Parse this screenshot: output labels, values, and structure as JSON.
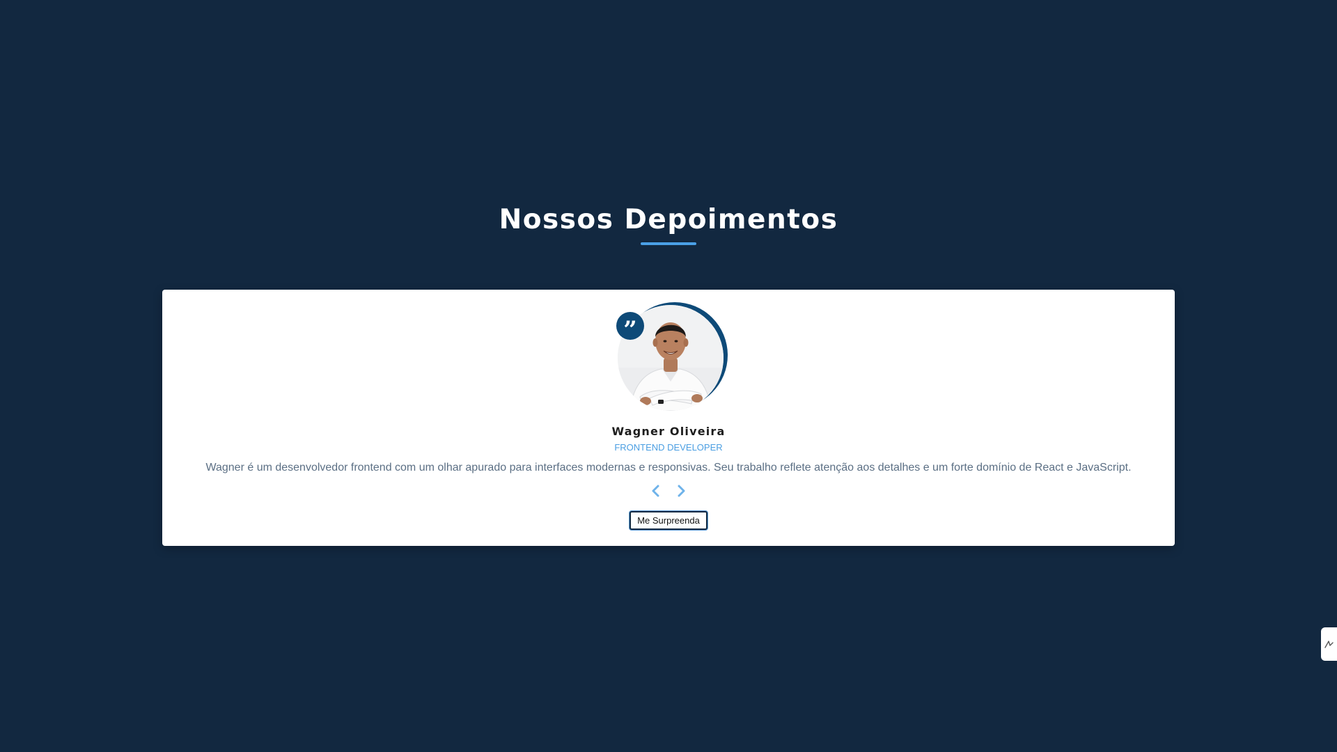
{
  "section": {
    "title": "Nossos Depoimentos"
  },
  "testimonial": {
    "name": "Wagner Oliveira",
    "role": "FRONTEND DEVELOPER",
    "text": "Wagner é um desenvolvedor frontend com um olhar apurado para interfaces modernas e responsivas. Seu trabalho reflete atenção aos detalhes e um forte domínio de React e JavaScript.",
    "quote_mark": "”"
  },
  "controls": {
    "surprise_label": "Me Surpreenda",
    "prev_icon": "chevron-left-icon",
    "next_icon": "chevron-right-icon"
  },
  "colors": {
    "background": "#122840",
    "accent": "#4aa0e6",
    "brand_dark": "#0e4a78"
  }
}
